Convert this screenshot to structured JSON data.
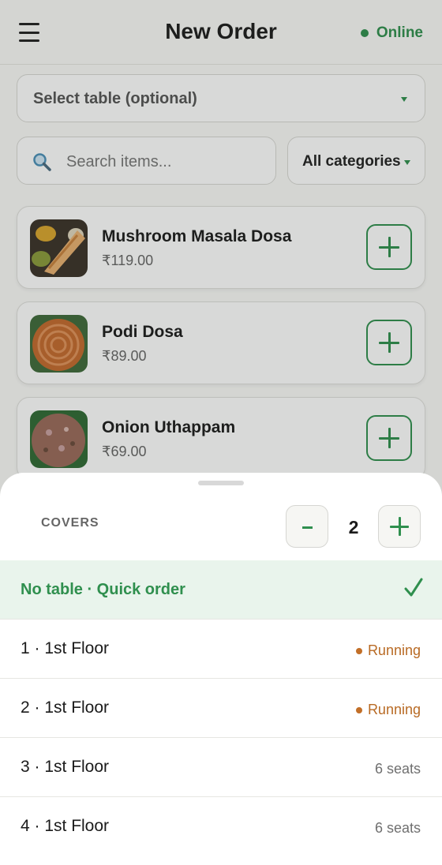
{
  "header": {
    "title": "New Order",
    "status_label": "Online",
    "status_color": "#2f8f4e",
    "menu_icon": "hamburger-menu-icon"
  },
  "filters": {
    "table_select_label": "Select table (optional)",
    "search_placeholder": "Search items...",
    "category_select_label": "All categories"
  },
  "menu_items": [
    {
      "name": "Mushroom Masala Dosa",
      "price": "₹119.00"
    },
    {
      "name": "Podi Dosa",
      "price": "₹89.00"
    },
    {
      "name": "Onion Uthappam",
      "price": "₹69.00"
    }
  ],
  "table_sheet": {
    "covers_label": "COVERS",
    "covers_value": "2",
    "options": [
      {
        "label": "No table · Quick order",
        "selected": true,
        "status": ""
      },
      {
        "label": "1 · 1st Floor",
        "status": "Running",
        "status_type": "running"
      },
      {
        "label": "2 · 1st Floor",
        "status": "Running",
        "status_type": "running"
      },
      {
        "label": "3 · 1st Floor",
        "status": "6 seats",
        "status_type": "seats"
      },
      {
        "label": "4 · 1st Floor",
        "status": "6 seats",
        "status_type": "seats"
      }
    ]
  },
  "colors": {
    "accent": "#2f8f4e",
    "running": "#b86a24",
    "selected_row_bg": "#e9f4ec"
  }
}
